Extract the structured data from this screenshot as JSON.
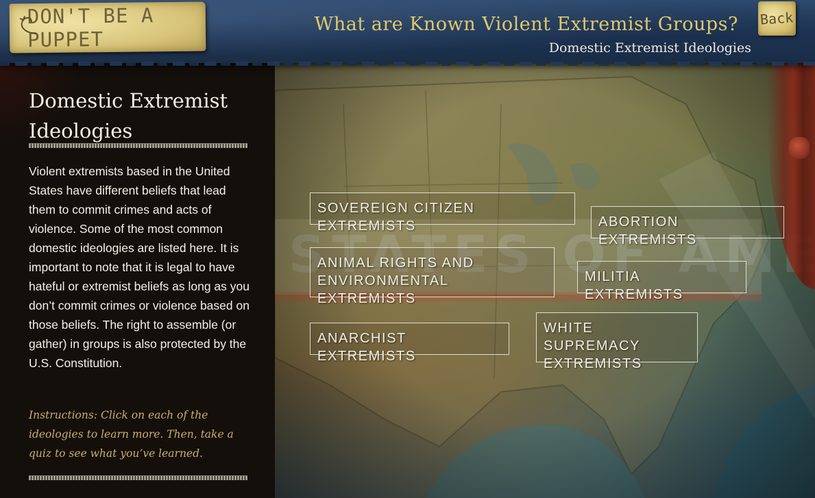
{
  "header": {
    "brand_label": "DON'T BE A PUPPET",
    "title": "What are Known Violent Extremist Groups?",
    "subtitle": "Domestic Extremist Ideologies",
    "back_label": "Back"
  },
  "panel": {
    "heading": "Domestic Extremist Ideologies",
    "body": "Violent extremists based in the United States have different beliefs that lead them to commit crimes and acts of violence. Some of the most common domestic ideologies are listed here. It is important to note that it is legal to have hateful or extremist beliefs as long as you don’t commit crimes or violence based on those beliefs. The right to assemble (or gather) in groups is also protected by the U.S. Constitution.",
    "instructions": "Instructions: Click on each of the ideologies to learn more. Then, take a quiz to see what you’ve learned."
  },
  "map": {
    "background_text": "STATES OF AMERICA"
  },
  "ideologies": [
    {
      "label": "SOVEREIGN CITIZEN EXTREMISTS"
    },
    {
      "label": "ABORTION EXTREMISTS"
    },
    {
      "label": "ANIMAL RIGHTS AND\nENVIRONMENTAL EXTREMISTS"
    },
    {
      "label": "MILITIA EXTREMISTS"
    },
    {
      "label": "ANARCHIST EXTREMISTS"
    },
    {
      "label": "WHITE SUPREMACY\nEXTREMISTS"
    }
  ],
  "colors": {
    "header_blue": "#243b5a",
    "title_gold": "#e2c86c",
    "instructions_gold": "#c9b06a",
    "tag_paper": "#d8c47a",
    "panel_dark": "#140f0b",
    "curtain_red": "#8c2a1a"
  }
}
